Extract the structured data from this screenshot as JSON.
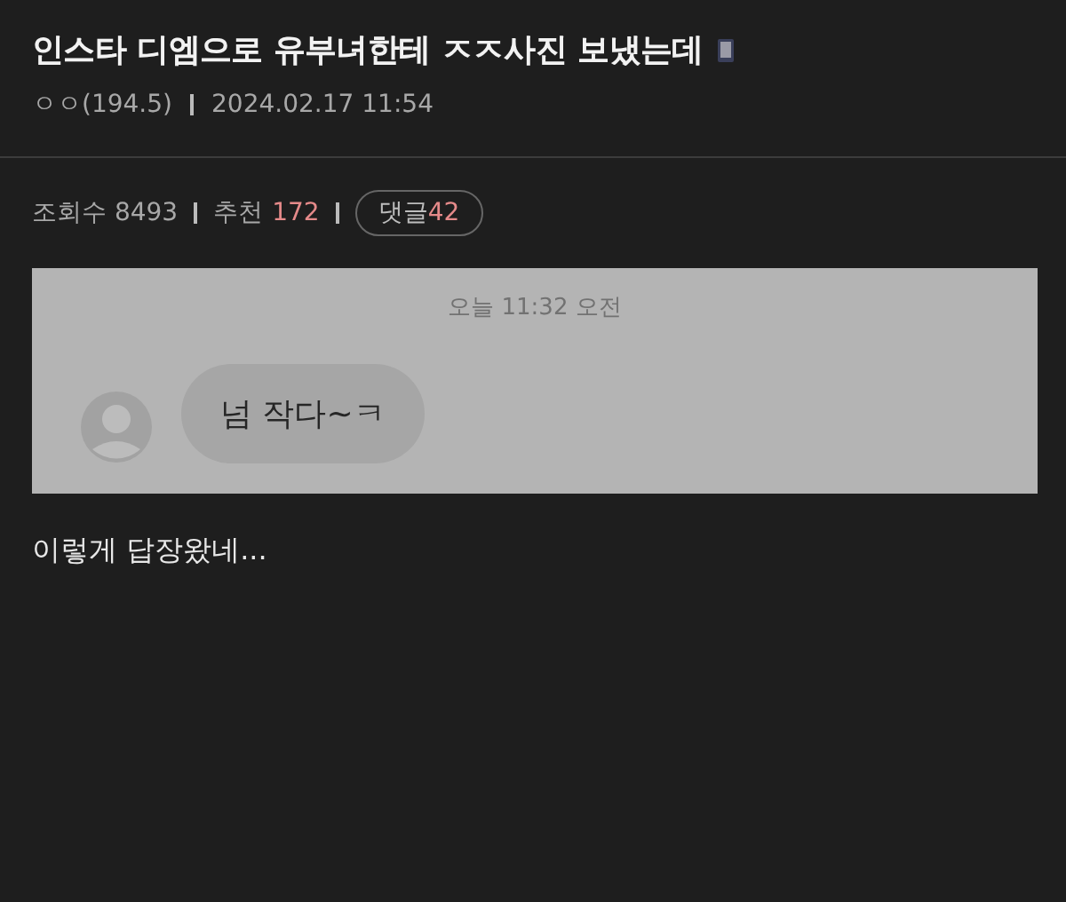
{
  "post": {
    "title": "인스타 디엠으로 유부녀한테 ㅈㅈ사진 보냈는데",
    "author": "ㅇㅇ(194.5)",
    "date": "2024.02.17 11:54"
  },
  "stats": {
    "views_label": "조회수",
    "views": "8493",
    "recommend_label": "추천",
    "recommend": "172",
    "comments_label": "댓글",
    "comments": "42"
  },
  "chat": {
    "timestamp": "오늘 11:32 오전",
    "message": "넘 작다~ㅋ"
  },
  "body": "이렇게 답장왔네..."
}
